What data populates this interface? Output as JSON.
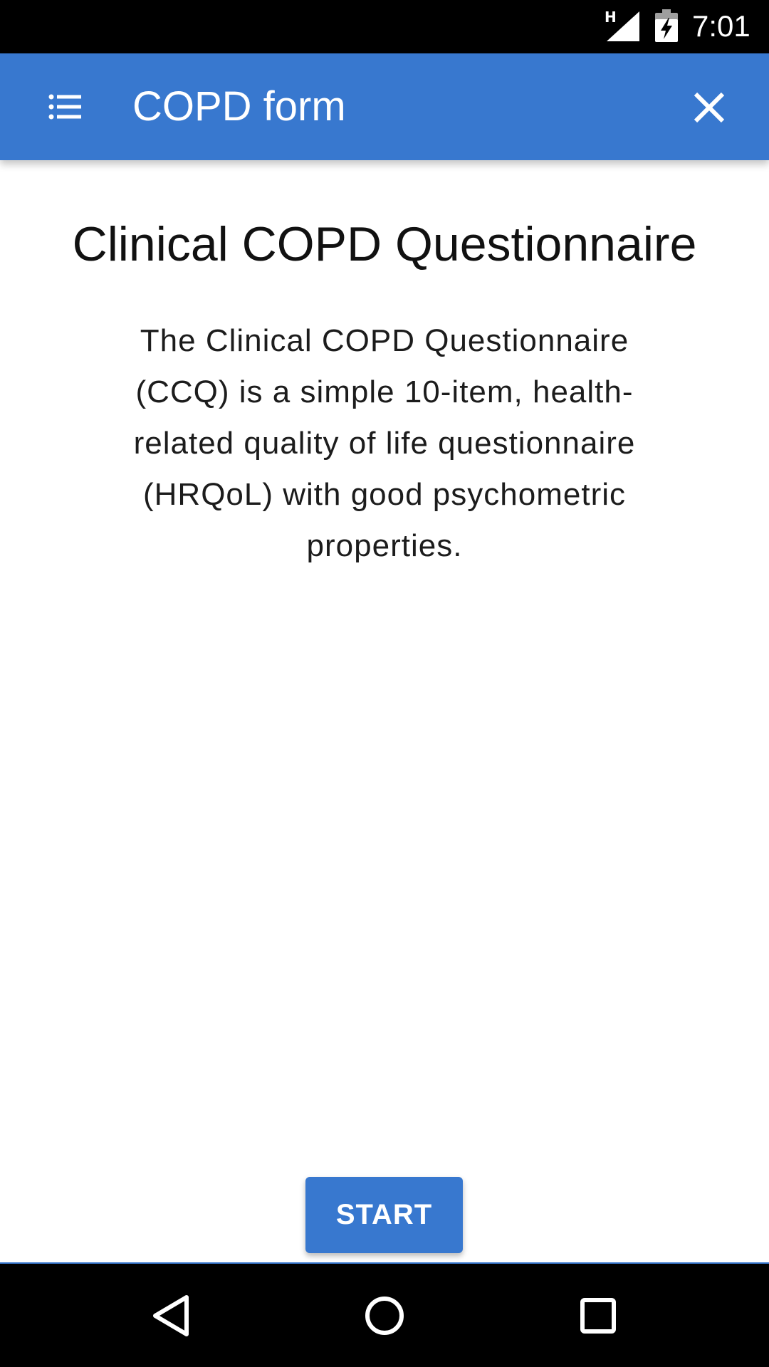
{
  "status_bar": {
    "network_type": "H",
    "time": "7:01"
  },
  "app_bar": {
    "title": "COPD form",
    "menu_icon": "list-menu-icon",
    "close_icon": "close-icon"
  },
  "content": {
    "heading": "Clinical COPD Questionnaire",
    "description": "The Clinical COPD Questionnaire (CCQ) is a simple 10-item, health-related quality of life questionnaire (HRQoL) with good psychometric properties."
  },
  "actions": {
    "start_label": "START"
  },
  "nav_bar": {
    "back_icon": "back-triangle-icon",
    "home_icon": "home-circle-icon",
    "recents_icon": "recents-square-icon"
  },
  "colors": {
    "primary": "#3878cf",
    "status_bar": "#000000",
    "nav_bar": "#000000",
    "background": "#ffffff"
  }
}
